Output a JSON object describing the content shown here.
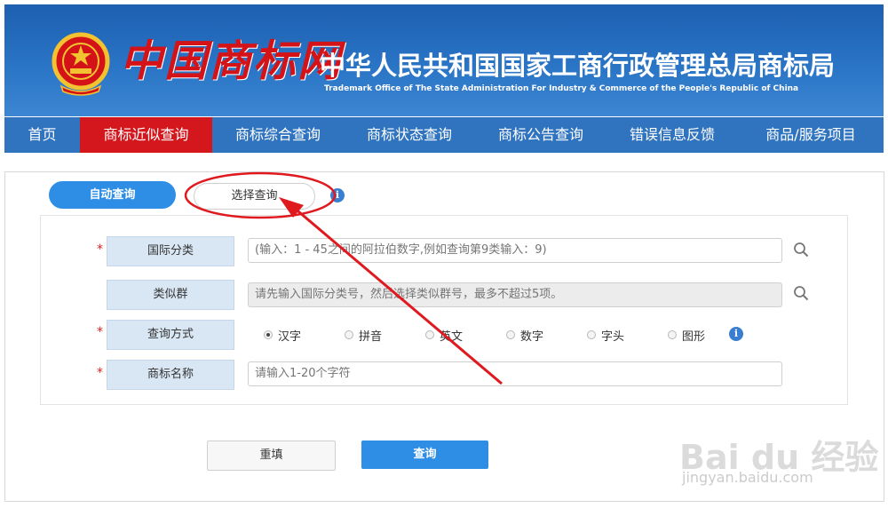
{
  "header": {
    "logo_text": "中国商标网",
    "office_cn": "中华人民共和国国家工商行政管理总局商标局",
    "office_en": "Trademark Office of The State Administration For Industry & Commerce of the People's Republic of China"
  },
  "nav": {
    "items": [
      "首页",
      "商标近似查询",
      "商标综合查询",
      "商标状态查询",
      "商标公告查询",
      "错误信息反馈",
      "商品/服务项目"
    ],
    "active_index": 1
  },
  "tabs": {
    "auto_label": "自动查询",
    "select_label": "选择查询"
  },
  "form": {
    "intl_class": {
      "label": "国际分类",
      "placeholder": "(输入：1 - 45之间的阿拉伯数字,例如查询第9类输入：9)"
    },
    "similar_group": {
      "label": "类似群",
      "placeholder": "请先输入国际分类号，然后选择类似群号，最多不超过5项。"
    },
    "query_mode": {
      "label": "查询方式",
      "options": [
        "汉字",
        "拼音",
        "英文",
        "数字",
        "字头",
        "图形"
      ],
      "selected": "汉字"
    },
    "trademark_name": {
      "label": "商标名称",
      "placeholder": "请输入1-20个字符"
    },
    "required_mark": "*"
  },
  "buttons": {
    "reset": "重填",
    "query": "查询"
  },
  "watermark": {
    "logo": "Bai du 经验",
    "url": "jingyan.baidu.com"
  },
  "colors": {
    "banner_blue": "#2a74c6",
    "nav_blue": "#3074bf",
    "active_red": "#d3171d",
    "accent_blue": "#2e8ee6",
    "annotation_red": "#e0191f"
  },
  "icons": {
    "emblem": "national-emblem-icon",
    "info": "info-icon",
    "search": "search-icon"
  }
}
